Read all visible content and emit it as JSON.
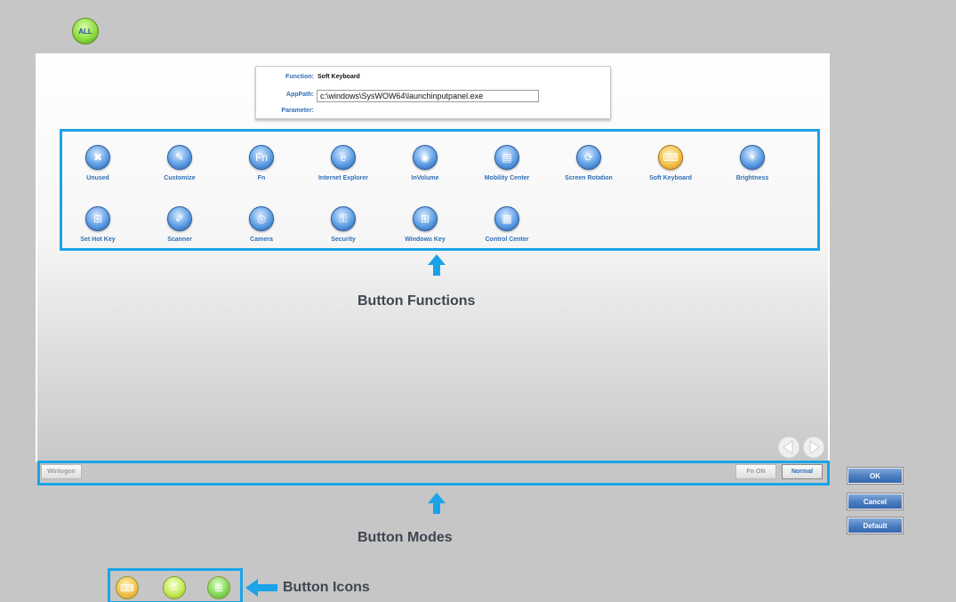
{
  "all_button": {
    "label": "ALL",
    "icon": "all-icon"
  },
  "info": {
    "function_label": "Function:",
    "function_value": "Soft Keyboard",
    "apppath_label": "AppPath:",
    "apppath_value": "c:\\windows\\SysWOW64\\launchinputpanel.exe",
    "parameter_label": "Parameter:"
  },
  "functions": [
    {
      "label": "Unused",
      "icon": "unused-icon",
      "glyph": "✖"
    },
    {
      "label": "Customize",
      "icon": "customize-icon",
      "glyph": "✎"
    },
    {
      "label": "Fn",
      "icon": "fn-icon",
      "glyph": "Fn"
    },
    {
      "label": "Internet Explorer",
      "icon": "internet-explorer-icon",
      "glyph": "e"
    },
    {
      "label": "InVolume",
      "icon": "volume-icon",
      "glyph": "◉"
    },
    {
      "label": "Mobility Center",
      "icon": "mobility-center-icon",
      "glyph": "▤"
    },
    {
      "label": "Screen Rotation",
      "icon": "screen-rotation-icon",
      "glyph": "⟳"
    },
    {
      "label": "Soft Keyboard",
      "icon": "soft-keyboard-icon",
      "glyph": "⌨",
      "selected": true
    },
    {
      "label": "Brightness",
      "icon": "brightness-icon",
      "glyph": "☀"
    },
    {
      "label": "Set Hot Key",
      "icon": "set-hot-key-icon",
      "glyph": "⊞"
    },
    {
      "label": "Scanner",
      "icon": "scanner-icon",
      "glyph": "✐"
    },
    {
      "label": "Camera",
      "icon": "camera-icon",
      "glyph": "◎"
    },
    {
      "label": "Security",
      "icon": "security-icon",
      "glyph": "⚿"
    },
    {
      "label": "Windows Key",
      "icon": "windows-key-icon",
      "glyph": "⊞"
    },
    {
      "label": "Control Center",
      "icon": "control-center-icon",
      "glyph": "▦"
    }
  ],
  "annotations": {
    "functions": "Button Functions",
    "modes": "Button Modes",
    "icons": "Button Icons"
  },
  "modes": {
    "winlogon": "Winlogon",
    "fn_on": "Fn ON",
    "normal": "Normal"
  },
  "dialog": {
    "ok": "OK",
    "cancel": "Cancel",
    "default": "Default"
  },
  "button_icons": [
    {
      "icon": "soft-keyboard-icon",
      "glyph": "⌨"
    },
    {
      "icon": "security-icon",
      "glyph": "⚿"
    },
    {
      "icon": "windows-key-icon",
      "glyph": "⊞"
    }
  ],
  "colors": {
    "background": "#c6c6c6",
    "highlight": "#1aa3e8",
    "label_blue": "#2f6fb5",
    "button_blue": "#4a7cc0"
  }
}
